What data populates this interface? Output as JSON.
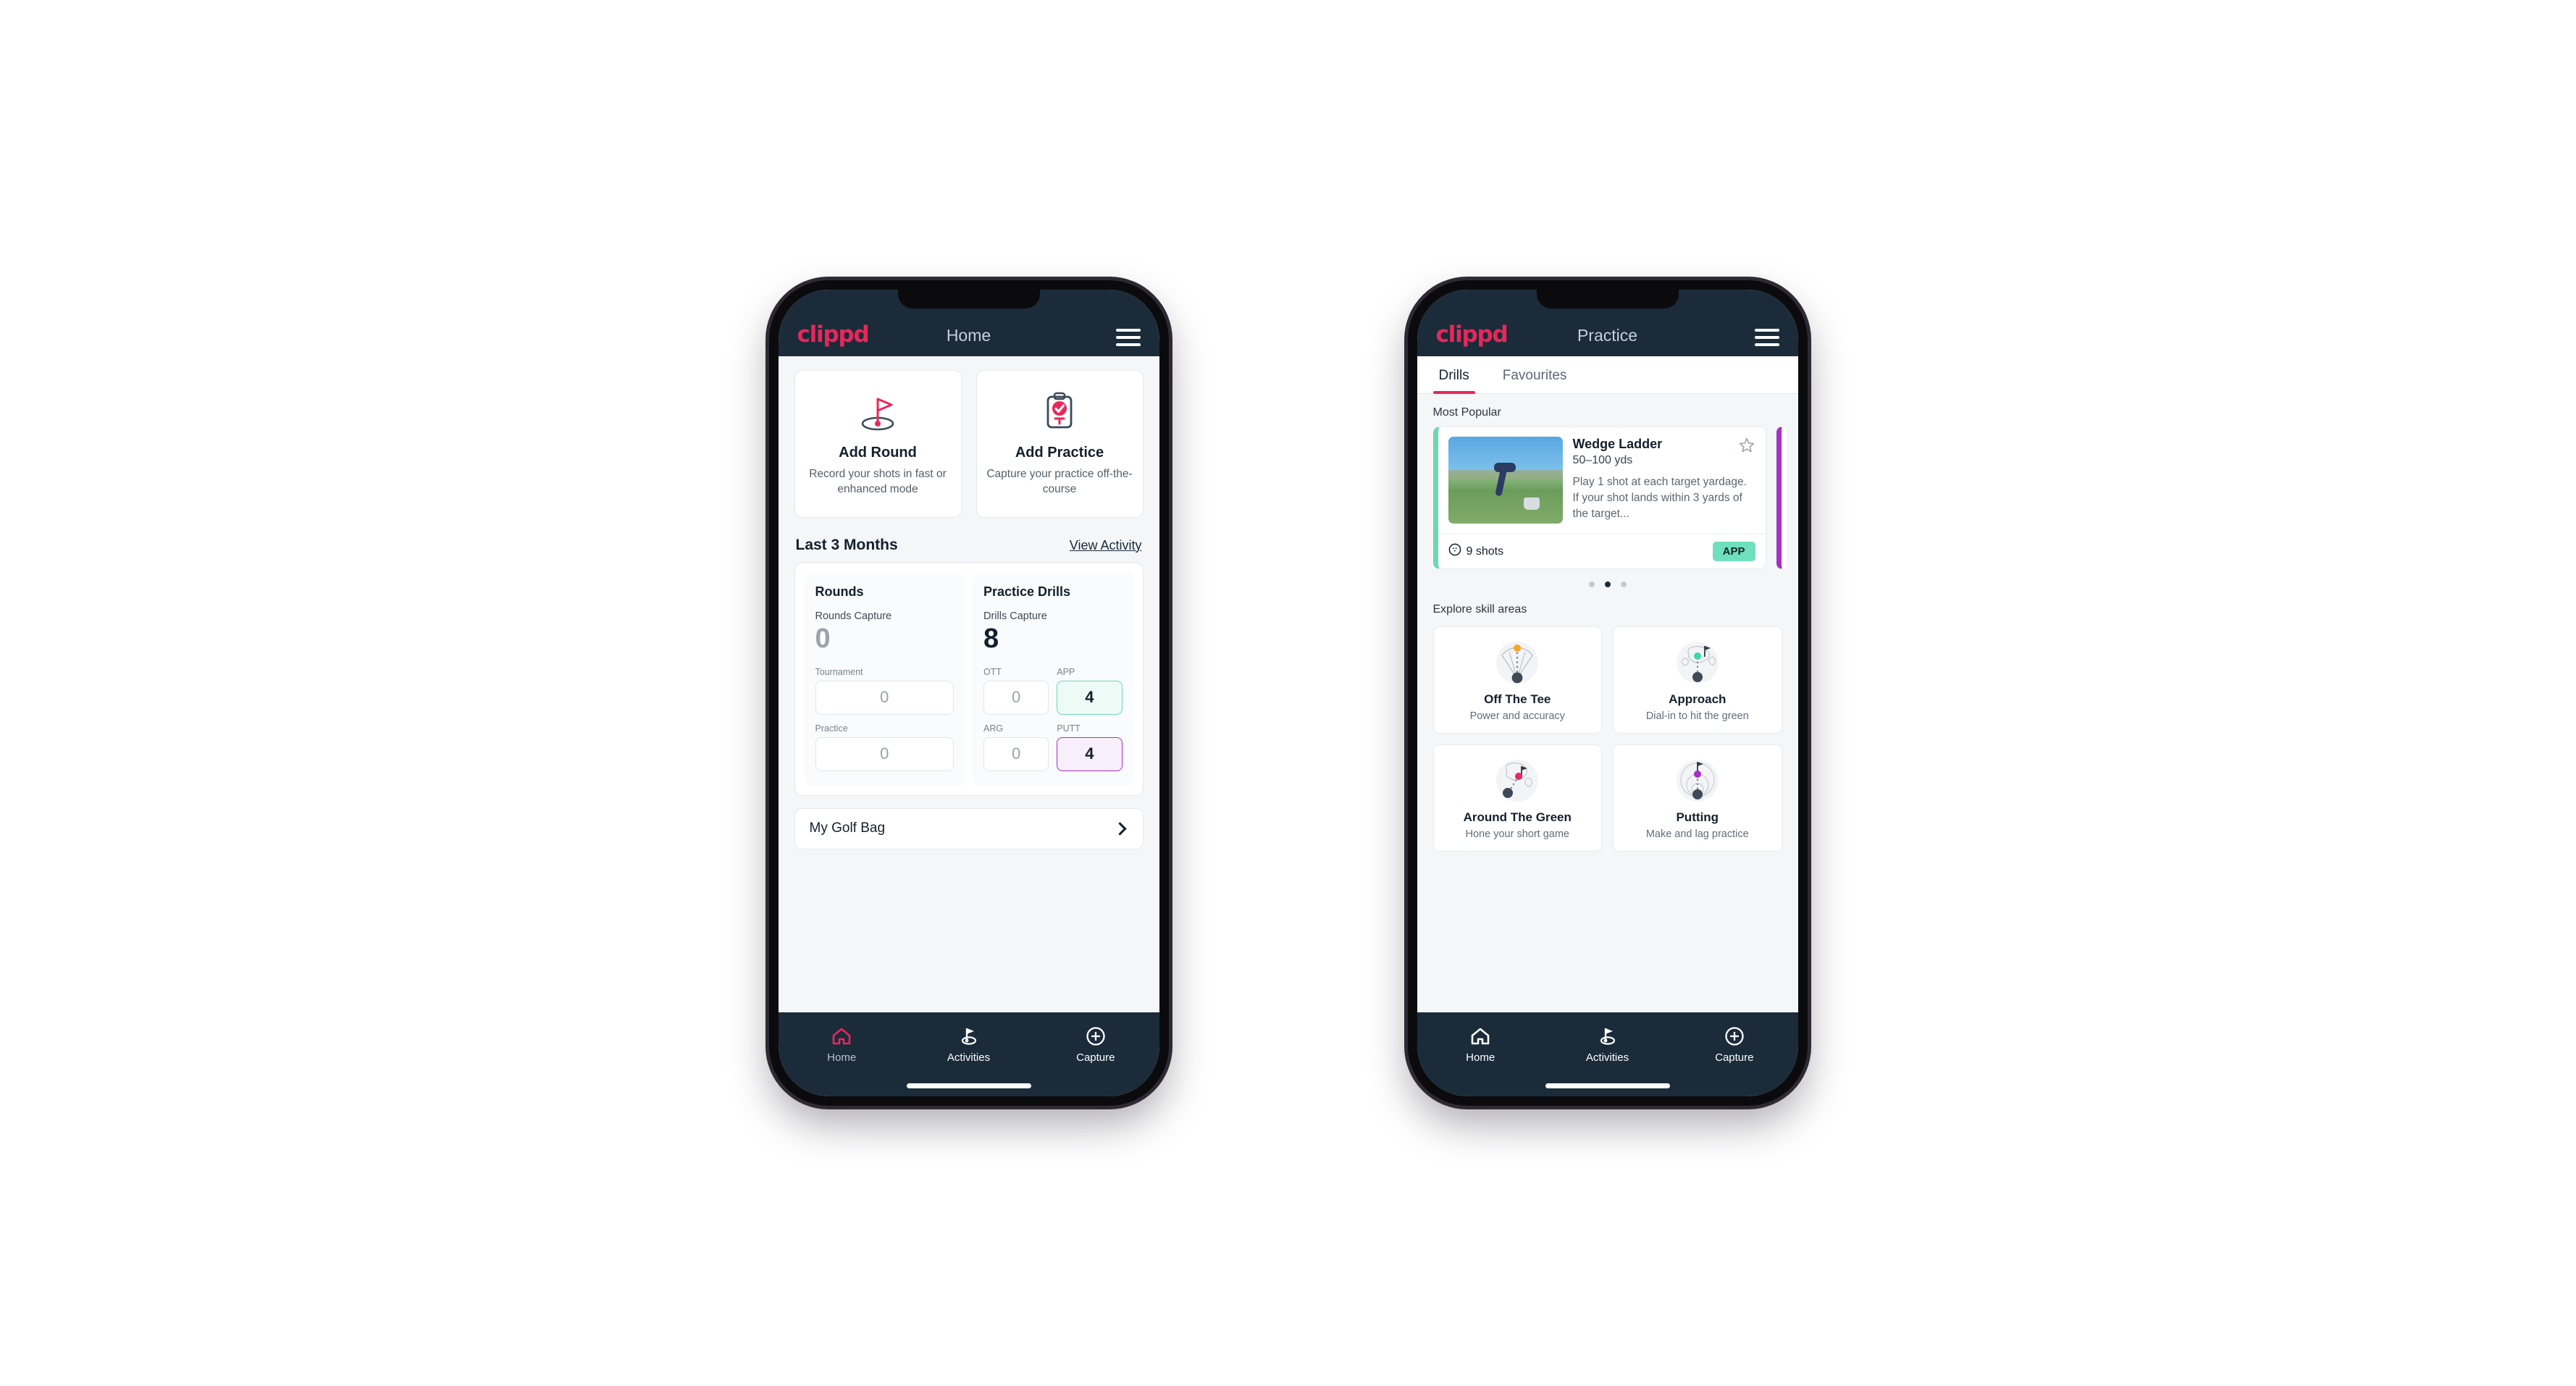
{
  "phones": [
    {
      "id": "home",
      "appbar": {
        "logo": "clippd",
        "title": "Home",
        "menu_icon": "hamburger-menu-icon"
      },
      "actions": [
        {
          "icon": "golf-flag-hole-icon",
          "title": "Add Round",
          "sub": "Record your shots in fast or enhanced mode"
        },
        {
          "icon": "clipboard-check-icon",
          "title": "Add Practice",
          "sub": "Capture your practice off-the-course"
        }
      ],
      "section": {
        "title": "Last 3 Months",
        "link": "View Activity"
      },
      "stats": {
        "rounds": {
          "heading": "Rounds",
          "capture_label": "Rounds Capture",
          "capture_value": "0",
          "fields": [
            {
              "label": "Tournament",
              "value": "0",
              "accent": "none"
            },
            {
              "label": "Practice",
              "value": "0",
              "accent": "none"
            }
          ]
        },
        "drills": {
          "heading": "Practice Drills",
          "capture_label": "Drills Capture",
          "capture_value": "8",
          "fields": [
            {
              "label": "OTT",
              "value": "0",
              "accent": "none"
            },
            {
              "label": "APP",
              "value": "4",
              "accent": "green"
            },
            {
              "label": "ARG",
              "value": "0",
              "accent": "none"
            },
            {
              "label": "PUTT",
              "value": "4",
              "accent": "purple"
            }
          ]
        }
      },
      "bag": {
        "label": "My Golf Bag",
        "icon": "chevron-right-icon"
      },
      "nav": [
        {
          "label": "Home",
          "icon": "home-icon",
          "active": true
        },
        {
          "label": "Activities",
          "icon": "golf-flag-icon",
          "active": false
        },
        {
          "label": "Capture",
          "icon": "plus-circle-icon",
          "active": false
        }
      ]
    },
    {
      "id": "practice",
      "appbar": {
        "logo": "clippd",
        "title": "Practice",
        "menu_icon": "hamburger-menu-icon"
      },
      "tabs": [
        {
          "label": "Drills",
          "active": true
        },
        {
          "label": "Favourites",
          "active": false
        }
      ],
      "most_popular_label": "Most Popular",
      "drill": {
        "name": "Wedge Ladder",
        "yardage": "50–100 yds",
        "description": "Play 1 shot at each target yardage. If your shot lands within 3 yards of the target...",
        "shots": "9 shots",
        "shots_icon": "golf-ball-icon",
        "tag": "APP",
        "tag_color": "#6fe0bc",
        "accent_color": "#6fd6b4",
        "next_accent_color": "#a430c6",
        "favourite_icon": "star-outline-icon",
        "thumbnail": "golfer-wedge-shot-photo"
      },
      "carousel_dots": [
        false,
        true,
        false
      ],
      "explore_label": "Explore skill areas",
      "skills": [
        {
          "title": "Off The Tee",
          "sub": "Power and accuracy",
          "icon": "tee-fan-icon",
          "dot_color": "#f5a623"
        },
        {
          "title": "Approach",
          "sub": "Dial-in to hit the green",
          "icon": "green-approach-icon",
          "dot_color": "#3ed6ac"
        },
        {
          "title": "Around The Green",
          "sub": "Hone your short game",
          "icon": "around-green-icon",
          "dot_color": "#e8275a"
        },
        {
          "title": "Putting",
          "sub": "Make and lag practice",
          "icon": "putting-rings-icon",
          "dot_color": "#a430c6"
        }
      ],
      "nav": [
        {
          "label": "Home",
          "icon": "home-icon",
          "active": false
        },
        {
          "label": "Activities",
          "icon": "golf-flag-icon",
          "active": true
        },
        {
          "label": "Capture",
          "icon": "plus-circle-icon",
          "active": false
        }
      ]
    }
  ],
  "colors": {
    "brand_pink": "#e8275a",
    "appbar_navy": "#1b2b3a",
    "page_bg": "#f4f6f8",
    "accent_green": "#6fd6b4",
    "accent_purple": "#a430c6"
  }
}
